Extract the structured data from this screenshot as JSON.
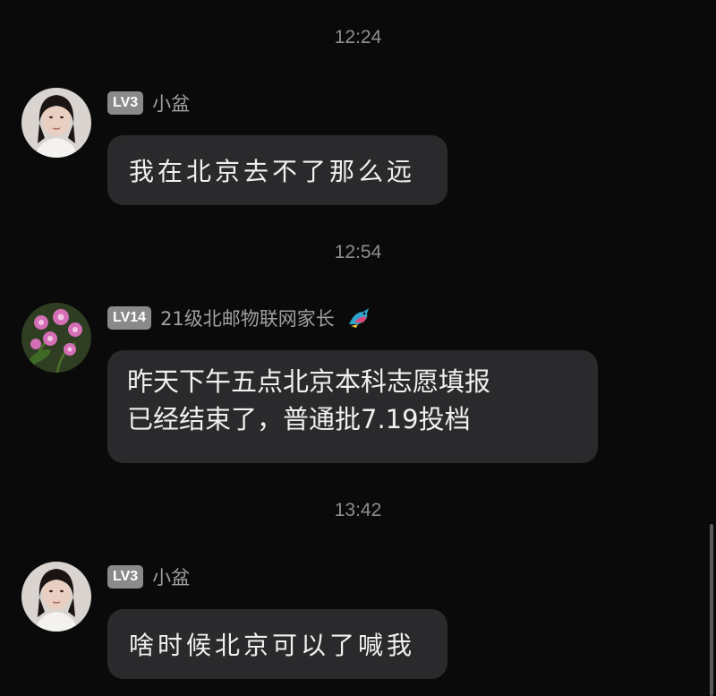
{
  "messages": [
    {
      "time": "12:24",
      "level": "LV3",
      "sender": "小盆",
      "text": "我在北京去不了那么远",
      "avatar": "woman-portrait-avatar"
    },
    {
      "time": "12:54",
      "level": "LV14",
      "sender": "21级北邮物联网家长",
      "sender_decoration": "colorful-bird-emoji",
      "text_lines": [
        "昨天下午五点北京本科志愿填报",
        "已经结束了，普通批7.19投档"
      ],
      "avatar": "orchid-flower-avatar"
    },
    {
      "time": "13:42",
      "level": "LV3",
      "sender": "小盆",
      "text": "啥时候北京可以了喊我",
      "avatar": "woman-portrait-avatar"
    }
  ],
  "colors": {
    "background": "#0a0a0a",
    "bubble": "#2a2a2c",
    "badge": "#8a8a8a",
    "timestamp": "#8e8e8e"
  }
}
